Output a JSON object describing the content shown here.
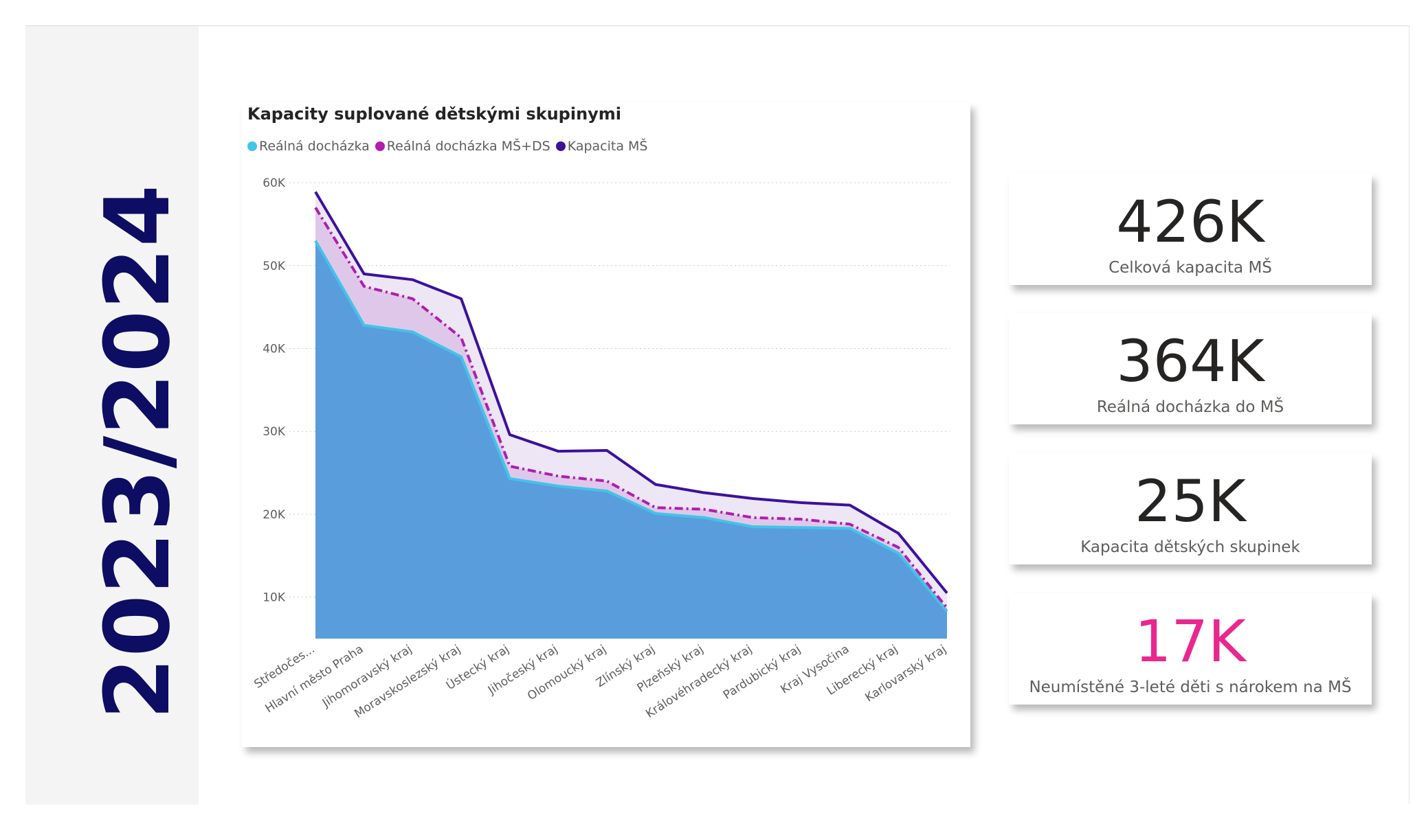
{
  "year_label": "2023/2024",
  "chart_data": {
    "type": "area",
    "title": "Kapacity suplované dětskými skupinymi",
    "categories": [
      "Středočes...",
      "Hlavní město Praha",
      "Jihomoravský kraj",
      "Moravskoslezský kraj",
      "Ústecký kraj",
      "Jihočeský kraj",
      "Olomoucký kraj",
      "Zlínský kraj",
      "Plzeňský kraj",
      "Královéhradecký kraj",
      "Pardubický kraj",
      "Kraj Vysočina",
      "Liberecký kraj",
      "Karlovarský kraj"
    ],
    "series": [
      {
        "name": "Reálná docházka",
        "color": "#41c4e8",
        "values": [
          53000,
          42800,
          42000,
          39000,
          24300,
          23400,
          22800,
          20100,
          19600,
          18500,
          18400,
          18300,
          15300,
          8300
        ]
      },
      {
        "name": "Reálná docházka MŠ+DS",
        "color": "#b01eab",
        "values": [
          57000,
          47500,
          46000,
          41300,
          25800,
          24600,
          24000,
          20800,
          20600,
          19600,
          19400,
          18800,
          16000,
          8700
        ]
      },
      {
        "name": "Kapacita MŠ",
        "color": "#3c119c",
        "values": [
          58900,
          49000,
          48300,
          46000,
          29600,
          27600,
          27700,
          23600,
          22600,
          21900,
          21400,
          21100,
          17700,
          10500
        ]
      }
    ],
    "y_ticks": [
      "60K",
      "50K",
      "40K",
      "30K",
      "20K",
      "10K"
    ],
    "y_tick_values": [
      60000,
      50000,
      40000,
      30000,
      20000,
      10000
    ],
    "ylim": [
      5000,
      61000
    ],
    "grid": true,
    "legend_position": "top-left",
    "colors": {
      "area_fill": "#5a9ddc",
      "band_inner": "#dfc7ea",
      "band_outer": "#ece6f5",
      "grid": "#cccccc",
      "axis_text": "#605e5c"
    }
  },
  "kpis": [
    {
      "value": "426K",
      "label": "Celková kapacita MŠ",
      "color": "#252423"
    },
    {
      "value": "364K",
      "label": "Reálná docházka do MŠ",
      "color": "#252423"
    },
    {
      "value": "25K",
      "label": "Kapacita dětských skupinek",
      "color": "#252423"
    },
    {
      "value": "17K",
      "label": "Neumístěné 3-leté děti s nárokem na MŠ",
      "color": "#e8288e"
    }
  ]
}
